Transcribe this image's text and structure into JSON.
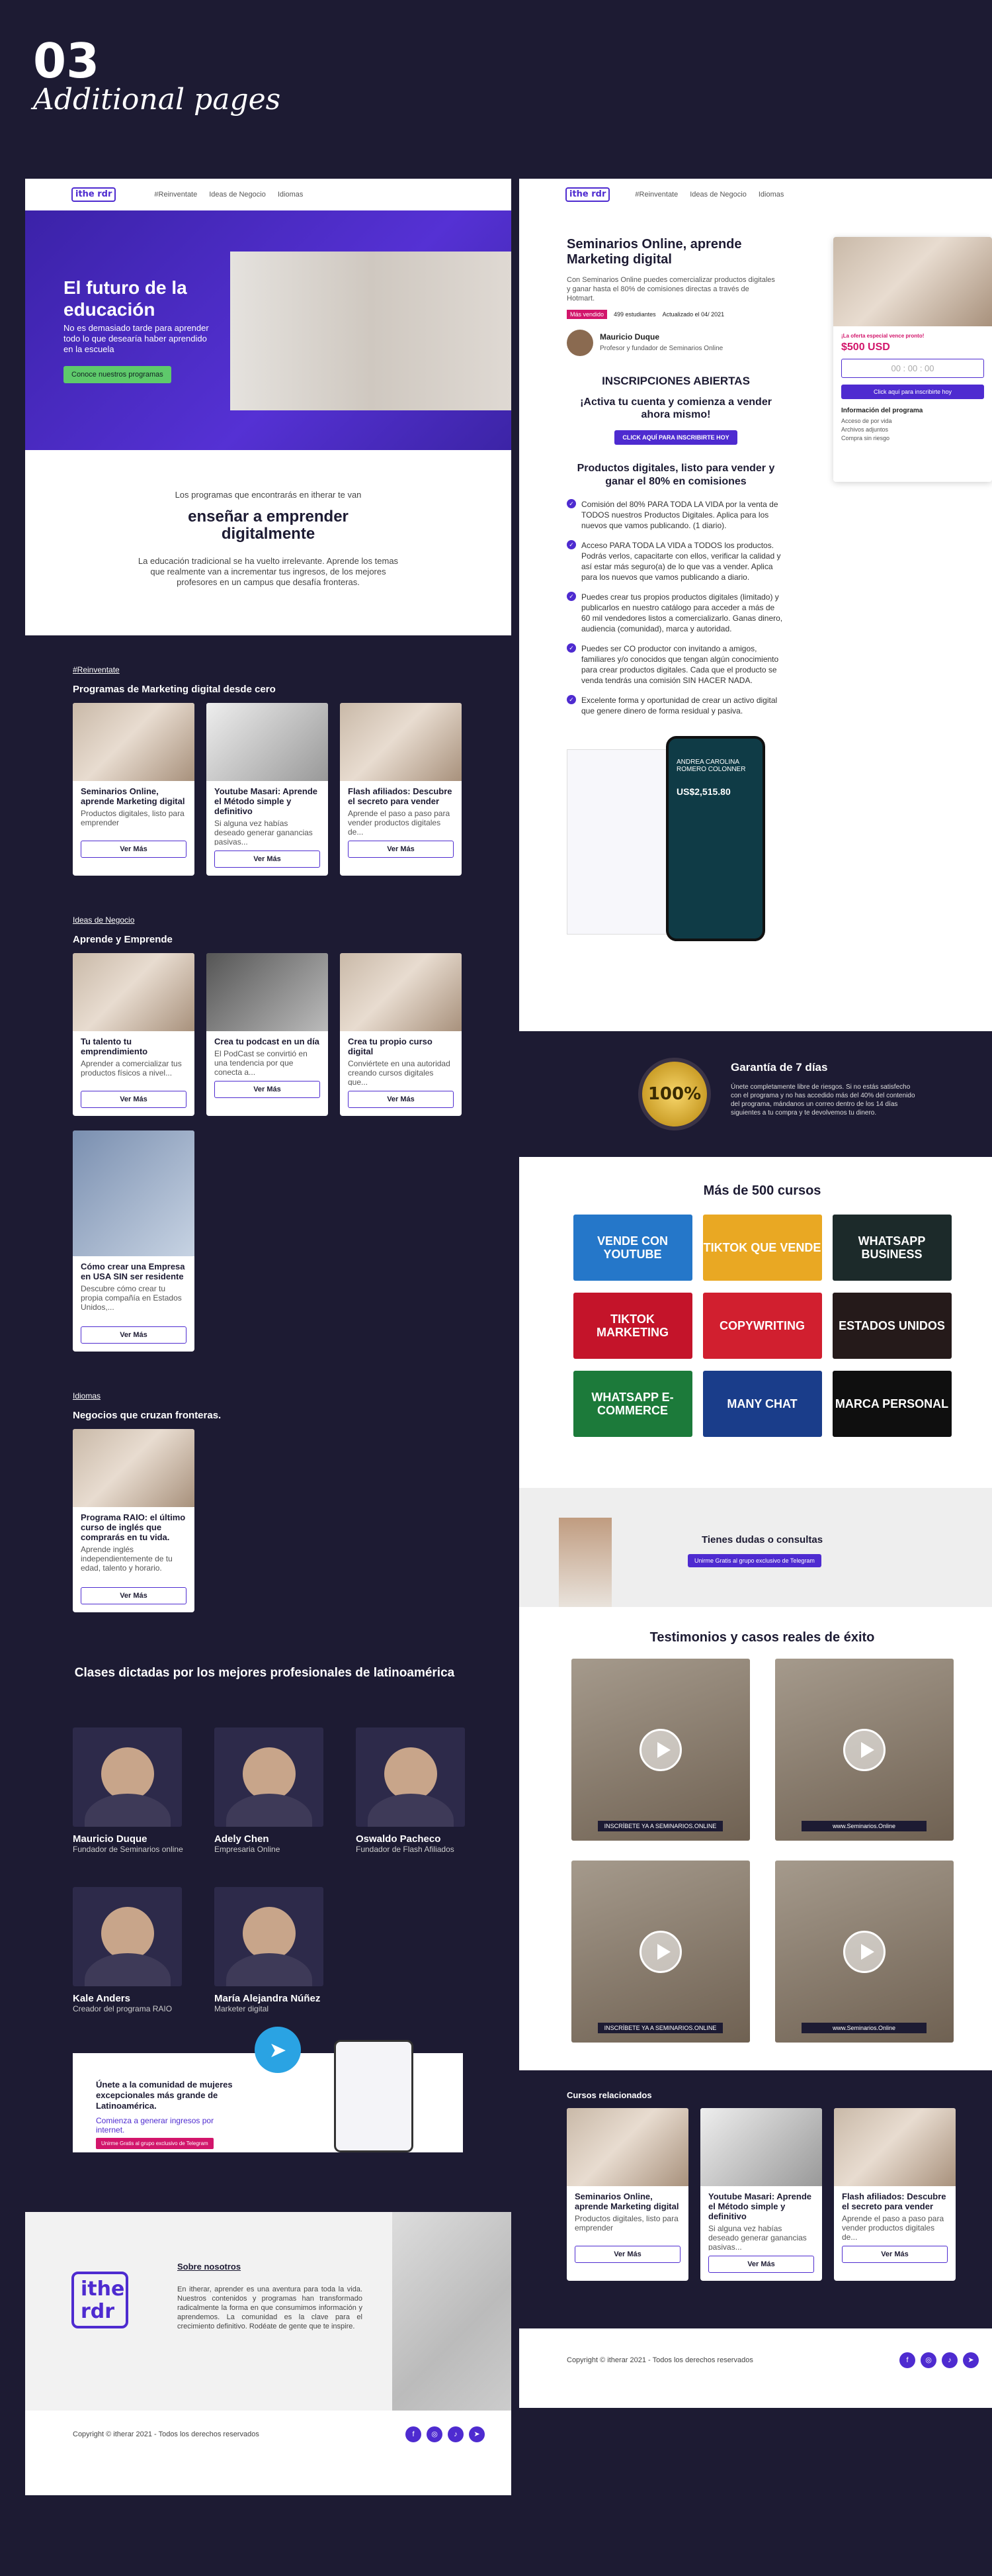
{
  "header": {
    "number": "03",
    "subtitle": "Additional pages"
  },
  "nav": {
    "logo": "ithe rdr",
    "items": [
      "#Reinventate",
      "Ideas de Negocio",
      "Idiomas"
    ]
  },
  "hero": {
    "title": "El futuro de la educación",
    "subtitle": "No es demasiado tarde para aprender todo lo que desearía haber aprendido en la escuela",
    "cta": "Conoce nuestros programas"
  },
  "intro": {
    "lead": "Los programas que encontrarás en itherar te van",
    "title": "enseñar a emprender digitalmente",
    "body": "La educación tradicional se ha vuelto irrelevante. Aprende los temas que realmente van a incrementar tus ingresos, de los mejores profesores en un campus que desafía fronteras."
  },
  "sections": [
    {
      "tag": "#Reinventate",
      "title": "Programas de Marketing digital desde cero",
      "cards": [
        {
          "title": "Seminarios Online, aprende Marketing digital",
          "desc": "Productos digitales, listo para emprender",
          "cta": "Ver Más"
        },
        {
          "title": "Youtube Masari: Aprende el Método simple y definitivo",
          "desc": "Si alguna vez habías deseado generar ganancias pasivas...",
          "cta": "Ver Más"
        },
        {
          "title": "Flash afiliados: Descubre el secreto para vender",
          "desc": "Aprende el paso a paso para vender productos digitales de...",
          "cta": "Ver Más"
        }
      ]
    },
    {
      "tag": "Ideas de Negocio",
      "title": "Aprende y Emprende",
      "cards": [
        {
          "title": "Tu talento tu emprendimiento",
          "desc": "Aprender a comercializar tus productos físicos a nivel...",
          "cta": "Ver Más"
        },
        {
          "title": "Crea tu podcast en un día",
          "desc": "El PodCast se convirtió en una tendencia por que conecta a...",
          "cta": "Ver Más"
        },
        {
          "title": "Crea tu propio curso digital",
          "desc": "Conviértete en una autoridad creando cursos digitales que...",
          "cta": "Ver Más"
        },
        {
          "title": "Cómo crear una Empresa en USA SIN ser residente",
          "desc": "Descubre cómo crear tu propia compañía en Estados Unidos,...",
          "cta": "Ver Más"
        }
      ]
    },
    {
      "tag": "Idiomas",
      "title": "Negocios que cruzan fronteras.",
      "cards": [
        {
          "title": "Programa RAIO: el último curso de inglés que comprarás en tu vida.",
          "desc": "Aprende inglés independientemente de tu edad, talento y horario.",
          "cta": "Ver Más"
        }
      ]
    }
  ],
  "instructors": {
    "title": "Clases dictadas por los mejores profesionales de latinoamérica",
    "people": [
      {
        "name": "Mauricio Duque",
        "role": "Fundador de Seminarios online"
      },
      {
        "name": "Adely Chen",
        "role": "Empresaria Online"
      },
      {
        "name": "Oswaldo Pacheco",
        "role": "Fundador de Flash Afiliados"
      },
      {
        "name": "Kale Anders",
        "role": "Creador del programa RAIO"
      },
      {
        "name": "María Alejandra Núñez",
        "role": "Marketer digital"
      }
    ]
  },
  "community": {
    "title": "Únete a la comunidad de mujeres excepcionales más grande de Latinoamérica.",
    "body": "Comienza a generar ingresos por internet.",
    "cta": "Unirme Gratis al grupo exclusivo de Telegram"
  },
  "about": {
    "title": "Sobre nosotros",
    "body": "En itherar, aprender es una aventura para toda la vida. Nuestros contenidos y programas han transformado radicalmente la forma en que consumimos información y aprendemos. La comunidad es la clave para el crecimiento definitivo. Rodéate de gente que te inspire."
  },
  "footer": {
    "copyright": "Copyright © itherar 2021 - Todos los derechos reservados",
    "social": [
      "f",
      "◎",
      "♪",
      "➤"
    ]
  },
  "product": {
    "title": "Seminarios Online, aprende Marketing digital",
    "desc": "Con Seminarios Online puedes comercializar productos digitales y ganar hasta el 80% de comisiones directas a través de Hotmart.",
    "badge": "Más vendido",
    "students": "499 estudiantes",
    "updated": "Actualizado el 04/ 2021",
    "author": "Mauricio Duque",
    "authorRole": "Profesor y fundador de Seminarios Online",
    "openTitle": "INSCRIPCIONES ABIERTAS",
    "openSub": "¡Activa tu cuenta y comienza a vender ahora mismo!",
    "openCta": "CLICK AQUÍ PARA INSCRIBIRTE HOY",
    "listTitle": "Productos digitales, listo para vender y ganar el 80% en comisiones",
    "checks": [
      "Comisión del 80% PARA TODA LA VIDA por la venta de TODOS nuestros Productos Digitales. Aplica para los nuevos que vamos publicando. (1 diario).",
      "Acceso PARA TODA LA VIDA a TODOS los productos. Podrás verlos, capacitarte con ellos, verificar la calidad y así estar más seguro(a) de lo que vas a vender. Aplica para los nuevos que vamos publicando a diario.",
      "Puedes crear tus propios productos digitales (limitado) y publicarlos en nuestro catálogo para acceder a más de 60 mil vendedores listos a comercializarlo. Ganas dinero, audiencia (comunidad), marca y autoridad.",
      "Puedes ser CO productor con invitando a amigos, familiares y/o conocidos que tengan algún conocimiento para crear productos digitales. Cada que el producto se venda tendrás una comisión SIN HACER NADA.",
      "Excelente forma y oportunidad de crear un activo digital que genere dinero de forma residual y pasiva."
    ],
    "offer": "¡La oferta especial vence pronto!",
    "price": "$500 USD",
    "timer": "00 : 00 : 00",
    "buy": "Click aquí para inscribirte hoy",
    "infoTitle": "Información del programa",
    "info": [
      "Acceso de por vida",
      "Archivos adjuntos",
      "Compra sin riesgo"
    ],
    "phoneName": "ANDREA CAROLINA ROMERO COLONNER",
    "phoneAmount": "US$2,515.80"
  },
  "guarantee": {
    "badge": "100%",
    "title": "Garantía de 7 días",
    "body": "Únete completamente libre de riesgos. Si no estás satisfecho con el programa y no has accedido más del 40% del contenido del programa, mándanos un correo dentro de los 14 días siguientes a tu compra y te devolvemos tu dinero."
  },
  "courses": {
    "title": "Más de 500 cursos",
    "items": [
      "VENDE CON YOUTUBE",
      "TIKTOK QUE VENDE",
      "WHATSAPP BUSINESS",
      "TIKTOK MARKETING",
      "COPYWRITING",
      "ESTADOS UNIDOS",
      "WHATSAPP E-COMMERCE",
      "MANY CHAT",
      "MARCA PERSONAL"
    ]
  },
  "doubts": {
    "title": "Tienes dudas o consultas",
    "cta": "Unirme Gratis al grupo exclusivo de Telegram"
  },
  "testimonials": {
    "title": "Testimonios y casos reales de éxito",
    "captions": [
      "INSCRÍBETE YA A SEMINARIOS.ONLINE",
      "www.Seminarios.Online",
      "INSCRÍBETE YA A SEMINARIOS.ONLINE",
      "www.Seminarios.Online"
    ]
  },
  "related": {
    "title": "Cursos relacionados"
  }
}
